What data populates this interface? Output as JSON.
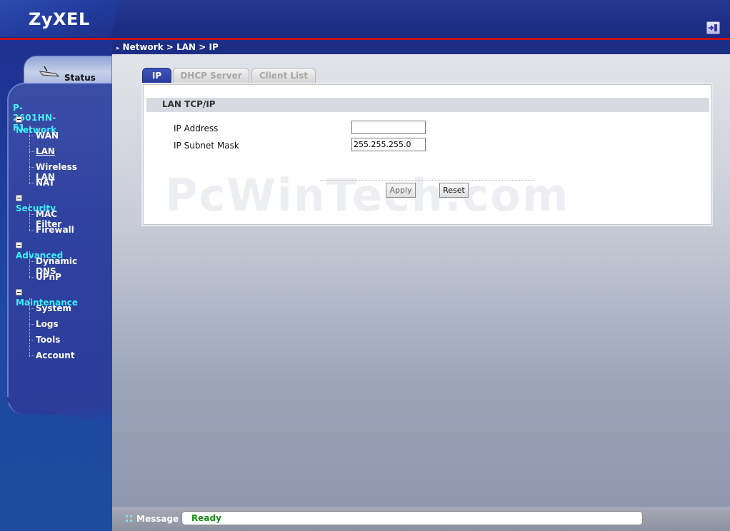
{
  "header": {
    "logo": "ZyXEL",
    "logout_icon": "logout-icon"
  },
  "sidebar": {
    "status_tab": {
      "label": "Status",
      "icon": "router-icon"
    },
    "device_name": "P-2601HN-F1",
    "categories": [
      {
        "label": "Network",
        "items": [
          "WAN",
          "LAN",
          "Wireless LAN",
          "NAT"
        ]
      },
      {
        "label": "Security",
        "items": [
          "MAC Filter",
          "Firewall"
        ]
      },
      {
        "label": "Advanced",
        "items": [
          "Dynamic DNS",
          "UPnP"
        ]
      },
      {
        "label": "Maintenance",
        "items": [
          "System",
          "Logs",
          "Tools",
          "Account"
        ]
      }
    ],
    "active_item": "LAN"
  },
  "breadcrumb": "Network > LAN > IP",
  "tabs": [
    {
      "label": "IP",
      "active": true
    },
    {
      "label": "DHCP Server",
      "active": false
    },
    {
      "label": "Client List",
      "active": false
    }
  ],
  "form": {
    "section_title": "LAN TCP/IP",
    "ip_address": {
      "label": "IP Address",
      "value": ""
    },
    "subnet_mask": {
      "label": "IP Subnet Mask",
      "value": "255.255.255.0"
    },
    "apply_label": "Apply",
    "reset_label": "Reset"
  },
  "watermark": "PcWinTech.com",
  "status_bar": {
    "label": "Message",
    "value": "Ready"
  },
  "colors": {
    "brand_blue": "#1d2f86",
    "accent_red": "#c5121a",
    "category_cyan": "#3cf0ff",
    "ready_green": "#1b8a1b"
  }
}
